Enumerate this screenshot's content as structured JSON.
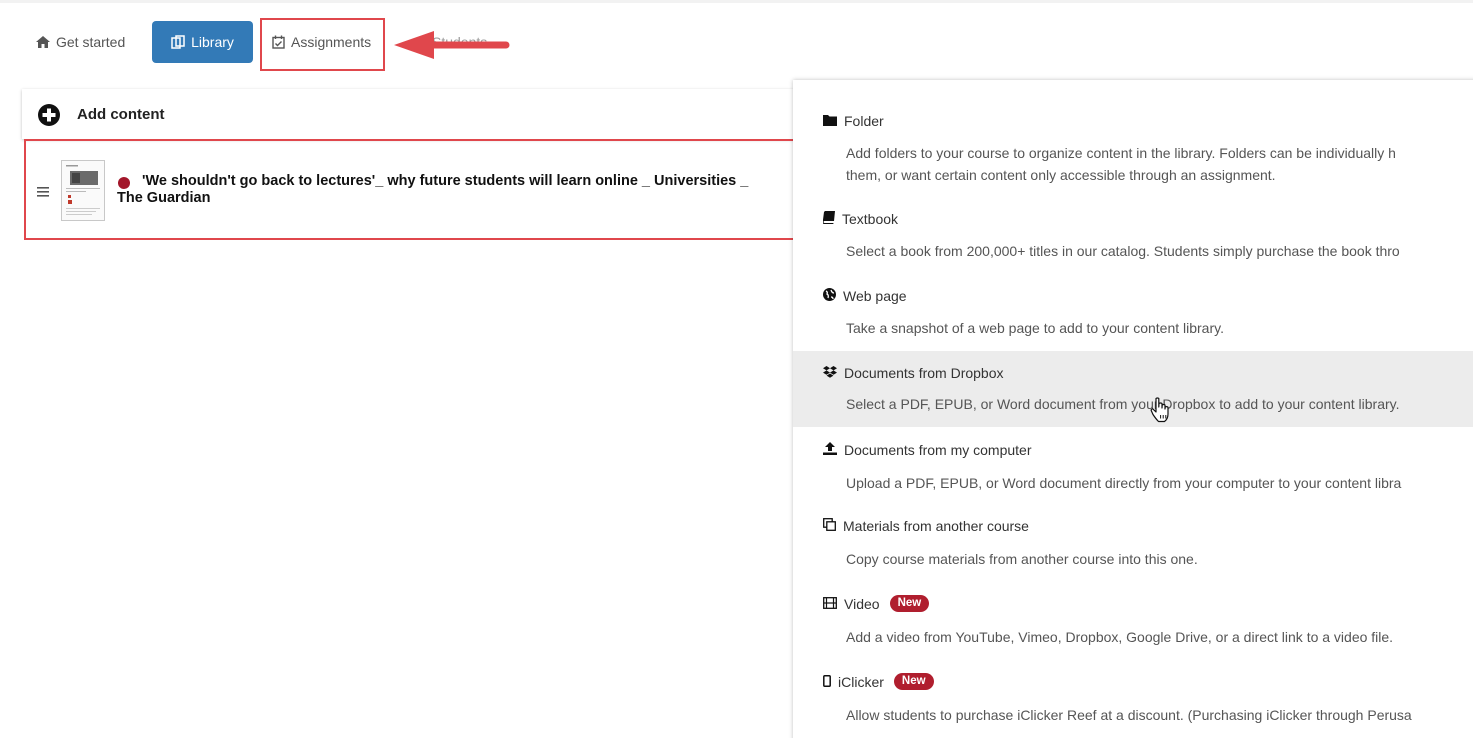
{
  "nav": {
    "tabs": [
      {
        "label": "Get started",
        "icon": "home-icon",
        "active": false
      },
      {
        "label": "Library",
        "icon": "library-icon",
        "active": true
      },
      {
        "label": "Assignments",
        "icon": "calendar-check-icon",
        "active": false
      },
      {
        "label": "Students",
        "icon": "",
        "active": false
      }
    ]
  },
  "library": {
    "add_content_label": "Add content",
    "documents": [
      {
        "title": "'We shouldn't go back to lectures'_ why future students will learn online _ Universities _ The Guardian",
        "status_color": "#a3162a"
      }
    ]
  },
  "menu": {
    "items": [
      {
        "title": "Folder",
        "icon": "folder-icon",
        "description": "Add folders to your course to organize content in the library. Folders can be individually h",
        "description_line2": "them, or want certain content only accessible through an assignment.",
        "badge": ""
      },
      {
        "title": "Textbook",
        "icon": "book-icon",
        "description": "Select a book from 200,000+ titles in our catalog. Students simply purchase the book thro",
        "badge": ""
      },
      {
        "title": "Web page",
        "icon": "globe-icon",
        "description": "Take a snapshot of a web page to add to your content library.",
        "badge": ""
      },
      {
        "title": "Documents from Dropbox",
        "icon": "dropbox-icon",
        "description": "Select a PDF, EPUB, or Word document from your Dropbox to add to your content library.",
        "badge": "",
        "hovered": true
      },
      {
        "title": "Documents from my computer",
        "icon": "upload-icon",
        "description": "Upload a PDF, EPUB, or Word document directly from your computer to your content libra",
        "badge": ""
      },
      {
        "title": "Materials from another course",
        "icon": "copy-icon",
        "description": "Copy course materials from another course into this one.",
        "badge": ""
      },
      {
        "title": "Video",
        "icon": "film-icon",
        "description": "Add a video from YouTube, Vimeo, Dropbox, Google Drive, or a direct link to a video file.",
        "badge": "New"
      },
      {
        "title": "iClicker",
        "icon": "mobile-icon",
        "description": "Allow students to purchase iClicker Reef at a discount. (Purchasing iClicker through Perusa",
        "badge": "New"
      }
    ]
  },
  "colors": {
    "primary": "#337ab7",
    "annotation_red": "#e0474c",
    "badge_red": "#b01e2e",
    "hover_bg": "#ececec"
  }
}
